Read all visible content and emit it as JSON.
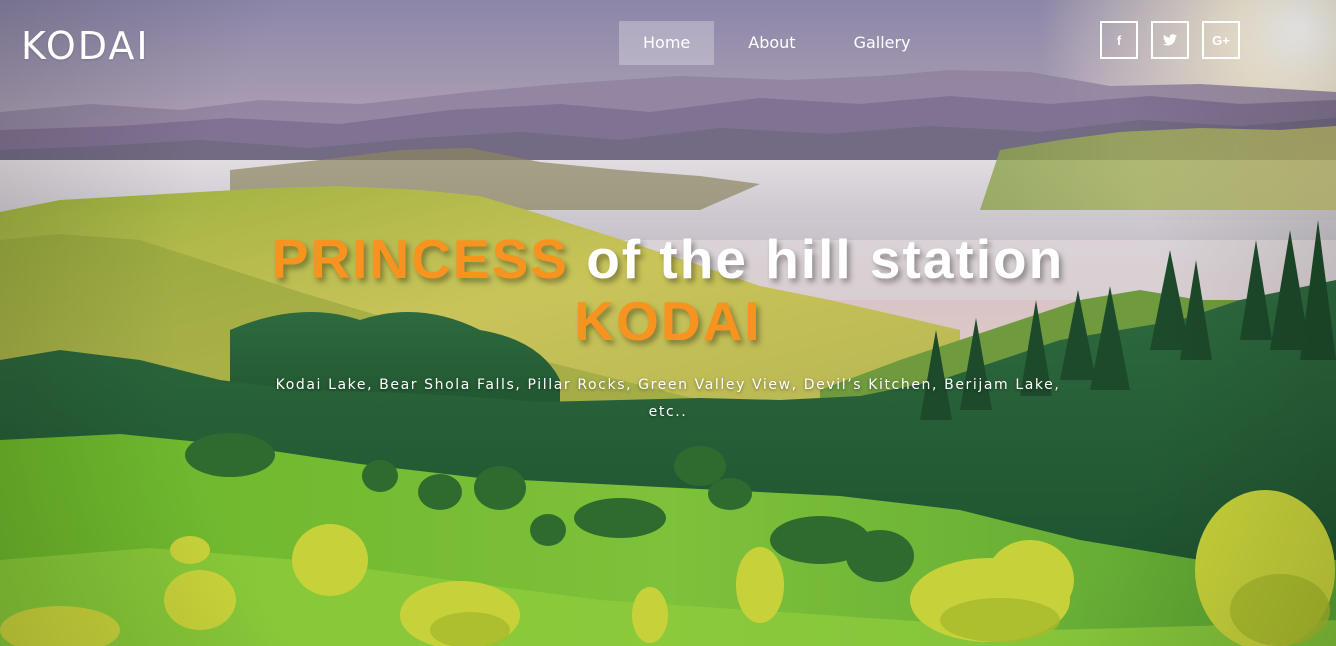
{
  "brand": {
    "logo_text": "KODAI"
  },
  "nav": {
    "items": [
      {
        "label": "Home",
        "active": true
      },
      {
        "label": "About",
        "active": false
      },
      {
        "label": "Gallery",
        "active": false
      }
    ]
  },
  "social": {
    "items": [
      {
        "label": "f",
        "icon": "facebook-icon"
      },
      {
        "label": "",
        "icon": "twitter-icon"
      },
      {
        "label": "G+",
        "icon": "google-plus-icon"
      }
    ]
  },
  "hero": {
    "headline_accent_1": "PRINCESS",
    "headline_mid": "of the hill station",
    "headline_accent_2": "KODAI",
    "tagline": "Kodai Lake, Bear Shola Falls, Pillar Rocks, Green Valley View, Devil’s Kitchen, Berijam Lake, etc.."
  },
  "colors": {
    "accent": "#f7931e",
    "text": "#ffffff"
  }
}
